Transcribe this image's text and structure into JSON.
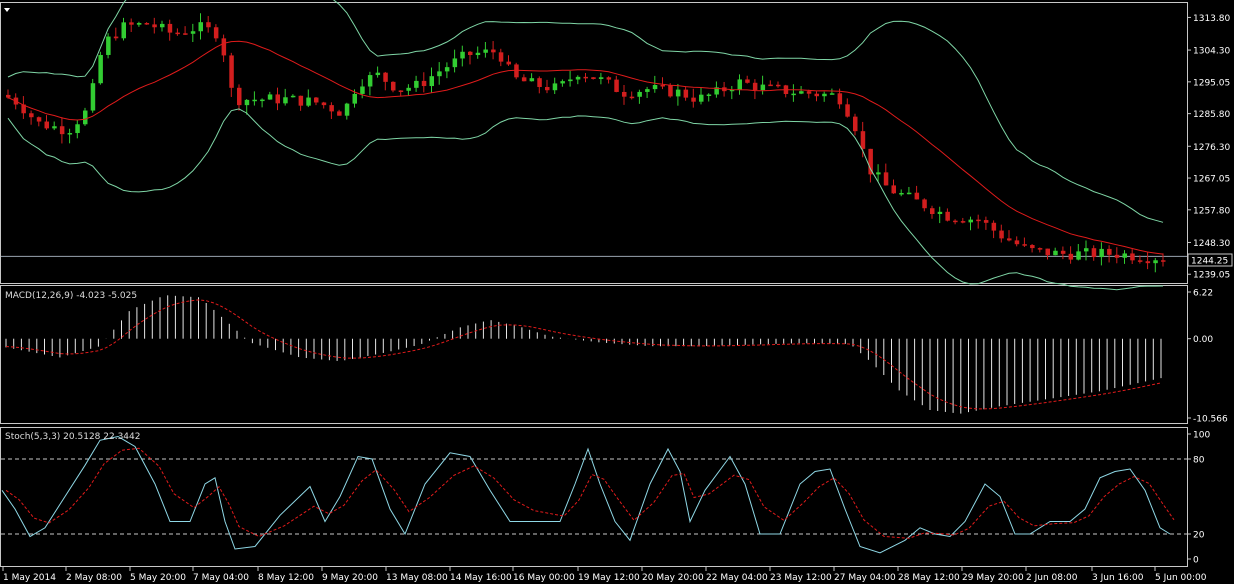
{
  "chart_data": [
    {
      "type": "candlestick",
      "panel": "price",
      "current_price": "1244.25",
      "y_ticks": [
        "1313.80",
        "1304.30",
        "1295.05",
        "1285.80",
        "1276.30",
        "1267.05",
        "1257.80",
        "1248.30",
        "1239.05"
      ],
      "ylim": [
        1236.5,
        1318
      ],
      "indicators": [
        "Bollinger Bands (green)",
        "Moving average (red)"
      ],
      "colors": {
        "up": "#32cd32",
        "down": "#d21e1e",
        "ma": "#e01b1b",
        "bands": "#7fd6a6"
      }
    },
    {
      "type": "histogram",
      "panel": "macd",
      "label": "MACD(12,26,9) -4.023 -5.025",
      "y_ticks": [
        "6.22",
        "0.00",
        "-10.566"
      ],
      "ylim": [
        -10.566,
        6.22
      ]
    },
    {
      "type": "line",
      "panel": "stochastic",
      "label": "Stoch(5,3,3) 20.5128 22.3442",
      "y_ticks": [
        "100",
        "80",
        "20",
        "0"
      ],
      "levels": [
        80,
        20
      ]
    }
  ],
  "x_ticks": [
    "1 May 2014",
    "2 May 08:00",
    "5 May 20:00",
    "7 May 04:00",
    "8 May 12:00",
    "9 May 20:00",
    "13 May 08:00",
    "14 May 16:00",
    "16 May 00:00",
    "19 May 12:00",
    "20 May 20:00",
    "22 May 04:00",
    "23 May 12:00",
    "27 May 04:00",
    "28 May 12:00",
    "29 May 20:00",
    "2 Jun 08:00",
    "3 Jun 16:00",
    "5 Jun 00:00"
  ]
}
